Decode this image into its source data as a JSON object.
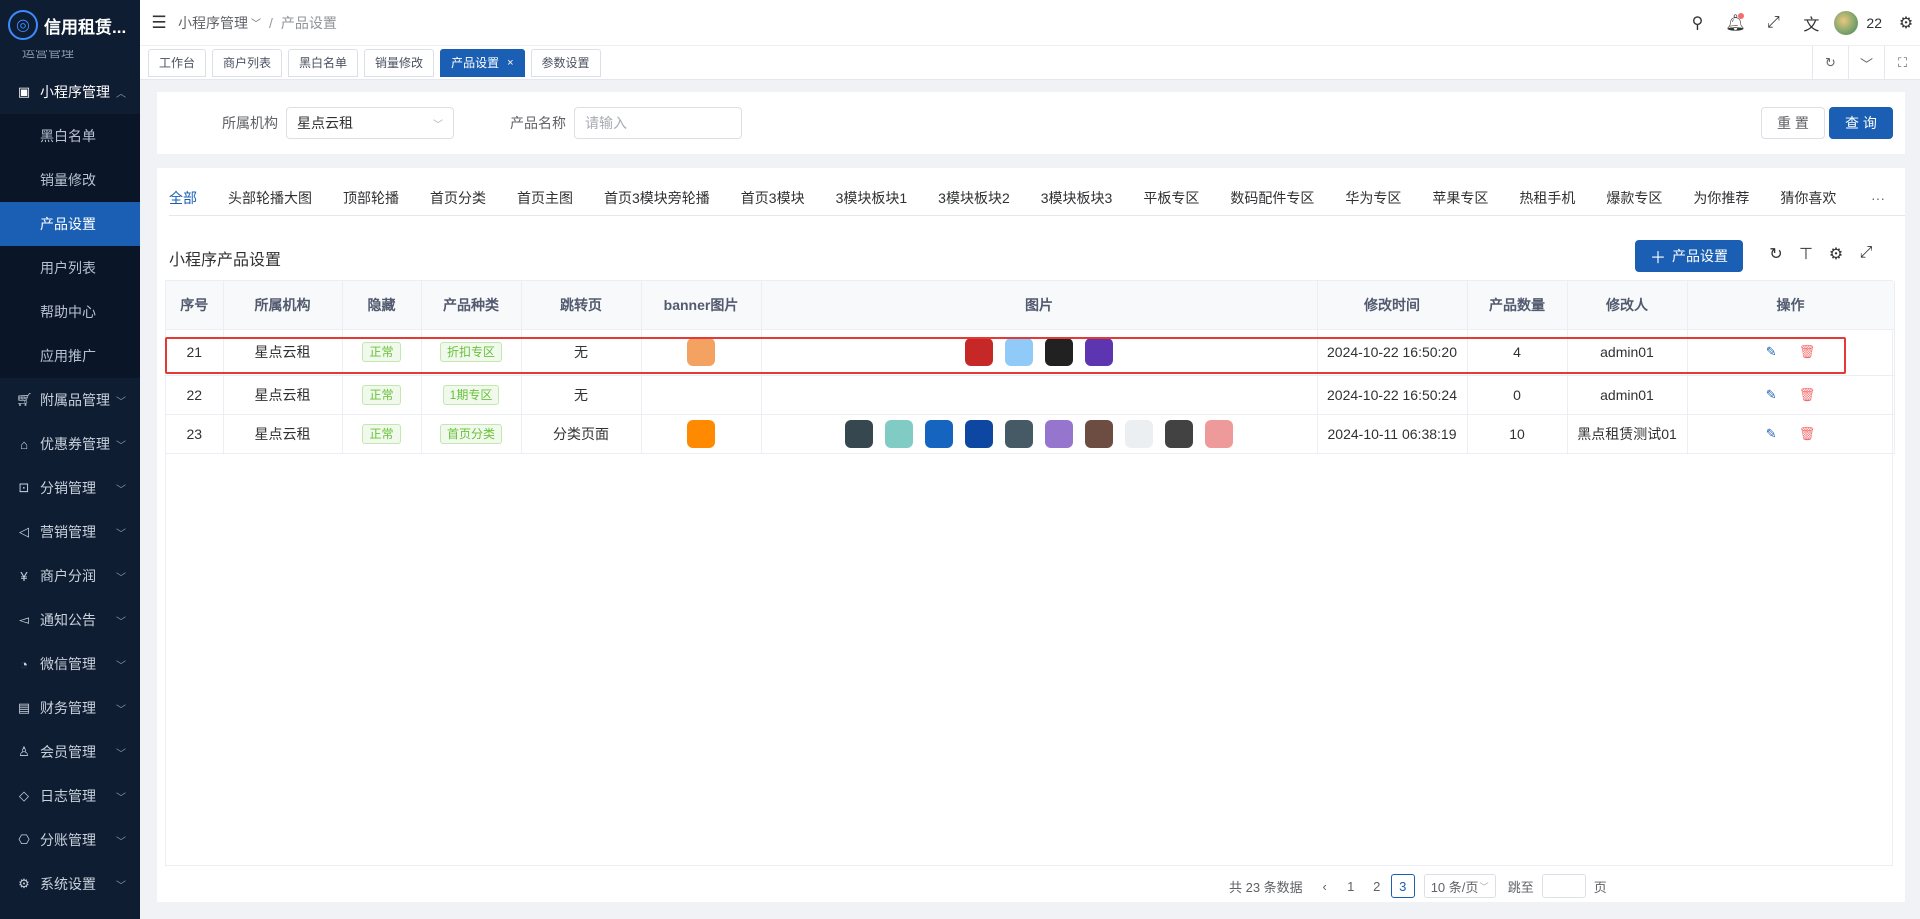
{
  "app": {
    "title": "信用租赁..."
  },
  "sidebar": {
    "clipped_item": "运营管理",
    "groups": [
      {
        "label": "小程序管理",
        "icon": "mini-program-icon",
        "open": true,
        "children": [
          "黑白名单",
          "销量修改",
          "产品设置",
          "用户列表",
          "帮助中心",
          "应用推广"
        ],
        "active_child": "产品设置"
      },
      {
        "label": "附属品管理",
        "icon": "cart-icon"
      },
      {
        "label": "优惠券管理",
        "icon": "gift-icon"
      },
      {
        "label": "分销管理",
        "icon": "share-icon"
      },
      {
        "label": "营销管理",
        "icon": "megaphone-icon"
      },
      {
        "label": "商户分润",
        "icon": "yen-icon"
      },
      {
        "label": "通知公告",
        "icon": "notice-icon"
      },
      {
        "label": "微信管理",
        "icon": "wechat-icon"
      },
      {
        "label": "财务管理",
        "icon": "finance-icon"
      },
      {
        "label": "会员管理",
        "icon": "member-icon"
      },
      {
        "label": "日志管理",
        "icon": "log-icon"
      },
      {
        "label": "分账管理",
        "icon": "split-icon"
      },
      {
        "label": "系统设置",
        "icon": "settings-icon"
      }
    ]
  },
  "header": {
    "breadcrumb": [
      "小程序管理",
      "产品设置"
    ],
    "user": "22"
  },
  "tags": {
    "items": [
      "工作台",
      "商户列表",
      "黑白名单",
      "销量修改",
      "产品设置",
      "参数设置"
    ],
    "active": "产品设置",
    "close": "×"
  },
  "search": {
    "org_label": "所属机构",
    "org_value": "星点云租",
    "name_label": "产品名称",
    "name_placeholder": "请输入",
    "reset": "重 置",
    "query": "查 询"
  },
  "category_tabs": {
    "items": [
      "全部",
      "头部轮播大图",
      "顶部轮播",
      "首页分类",
      "首页主图",
      "首页3模块旁轮播",
      "首页3模块",
      "3模块板块1",
      "3模块板块2",
      "3模块板块3",
      "平板专区",
      "数码配件专区",
      "华为专区",
      "苹果专区",
      "热租手机",
      "爆款专区",
      "为你推荐",
      "猜你喜欢"
    ],
    "active": "全部",
    "more": "···"
  },
  "table": {
    "title": "小程序产品设置",
    "add_button": "产品设置",
    "columns": [
      "序号",
      "所属机构",
      "隐藏",
      "产品种类",
      "跳转页",
      "banner图片",
      "图片",
      "修改时间",
      "产品数量",
      "修改人",
      "操作"
    ],
    "rows": [
      {
        "id": "21",
        "org": "星点云租",
        "hidden": "正常",
        "kind": "折扣专区",
        "jump": "无",
        "banner": true,
        "banner_color": "#f4a261",
        "images": [
          "#c62828",
          "#90caf9",
          "#212121",
          "#5e35b1"
        ],
        "time": "2024-10-22 16:50:20",
        "count": "4",
        "editor": "admin01"
      },
      {
        "id": "22",
        "org": "星点云租",
        "hidden": "正常",
        "kind": "1期专区",
        "jump": "无",
        "banner": false,
        "banner_color": "",
        "images": [],
        "time": "2024-10-22 16:50:24",
        "count": "0",
        "editor": "admin01"
      },
      {
        "id": "23",
        "org": "星点云租",
        "hidden": "正常",
        "kind": "首页分类",
        "jump": "分类页面",
        "banner": true,
        "banner_color": "#ff8a00",
        "images": [
          "#37474f",
          "#80cbc4",
          "#1565c0",
          "#0d47a1",
          "#455a64",
          "#9575cd",
          "#6d4c41",
          "#eceff1",
          "#424242",
          "#ef9a9a"
        ],
        "time": "2024-10-11 06:38:19",
        "count": "10",
        "editor": "黑点租赁测试01"
      }
    ]
  },
  "pagination": {
    "total": "共 23 条数据",
    "pages": [
      "1",
      "2",
      "3"
    ],
    "current": "3",
    "page_size": "10 条/页",
    "jump_label": "跳至",
    "page_suffix": "页"
  },
  "colors": {
    "primary": "#1a5fb4",
    "sidebar_bg": "#0f1d33",
    "highlight": "#e53935"
  }
}
